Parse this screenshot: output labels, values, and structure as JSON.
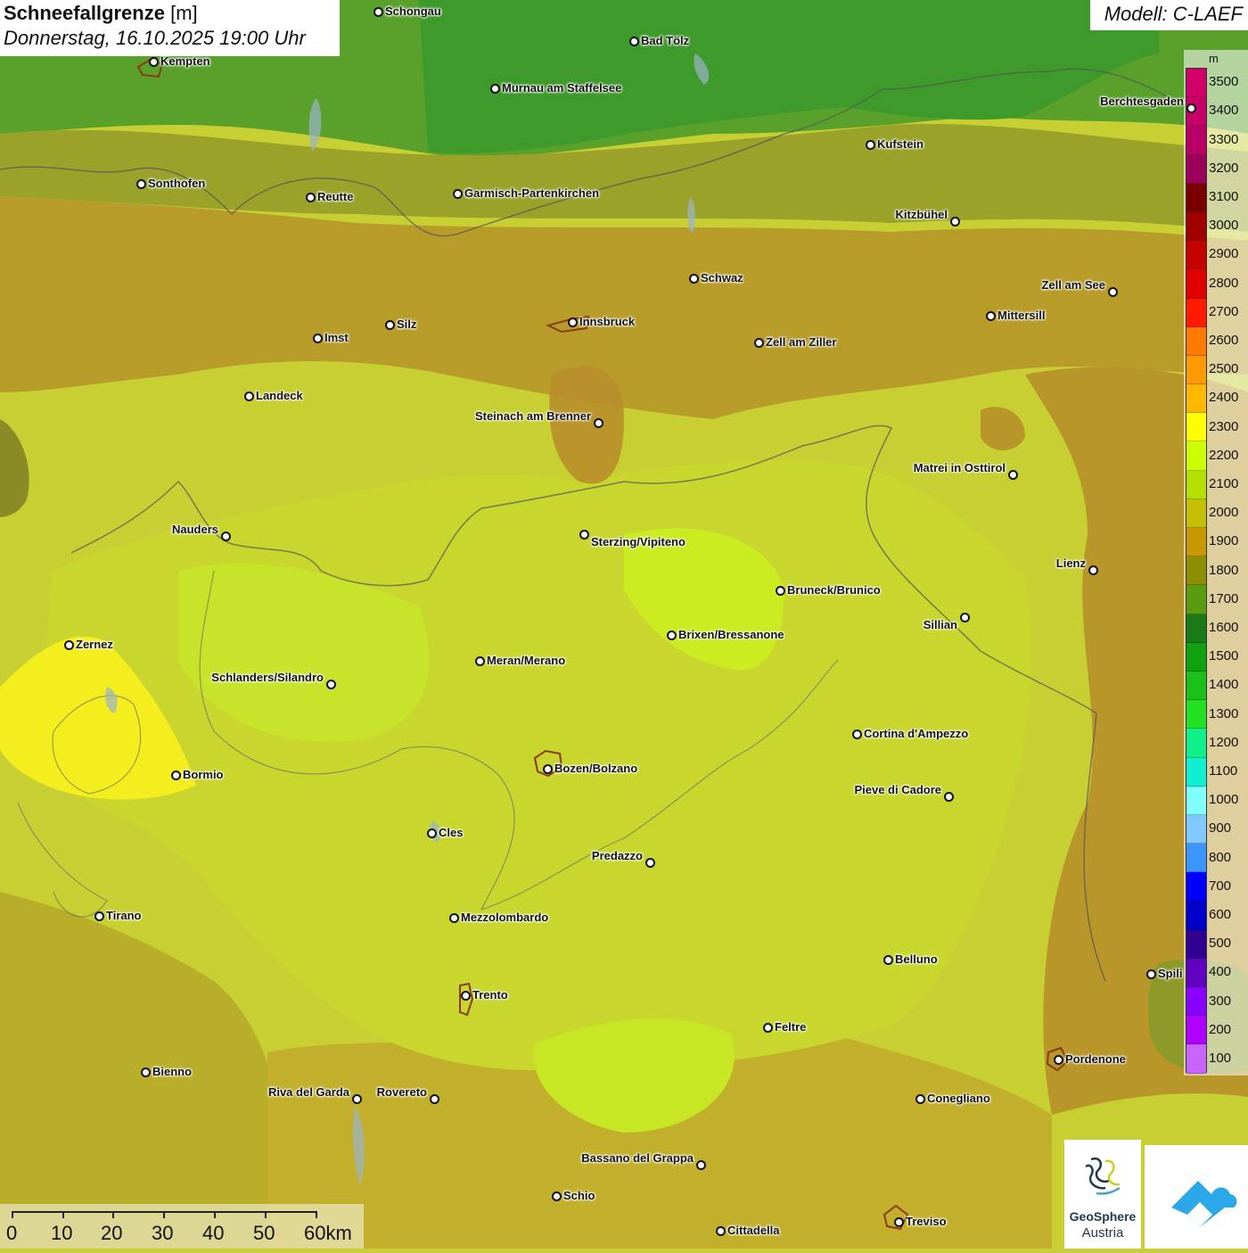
{
  "header": {
    "title": "Schneefallgrenze",
    "title_unit": "[m]",
    "datetime": "Donnerstag, 16.10.2025 19:00 Uhr",
    "model": "Modell: C-LAEF"
  },
  "legend": {
    "unit": "m",
    "labels": [
      "3500",
      "3400",
      "3300",
      "3200",
      "3100",
      "3000",
      "2900",
      "2800",
      "2700",
      "2600",
      "2500",
      "2400",
      "2300",
      "2200",
      "2100",
      "2000",
      "1900",
      "1800",
      "1700",
      "1600",
      "1500",
      "1400",
      "1300",
      "1200",
      "1100",
      "1000",
      "900",
      "800",
      "700",
      "600",
      "500",
      "400",
      "300",
      "200",
      "100"
    ],
    "colors": [
      "#d4006a",
      "#c8006a",
      "#b80066",
      "#9c0058",
      "#7a0000",
      "#a00000",
      "#c40000",
      "#e00000",
      "#ff1a00",
      "#ff7a00",
      "#ff9a00",
      "#ffb800",
      "#ffff00",
      "#ccff00",
      "#b4e000",
      "#c4bf00",
      "#c89800",
      "#8c9000",
      "#5c9a10",
      "#1a7a1a",
      "#10a010",
      "#18c018",
      "#22e022",
      "#10f08a",
      "#10f0d0",
      "#80ffff",
      "#80c8ff",
      "#3c96ff",
      "#0000ff",
      "#0000c8",
      "#300090",
      "#6000c0",
      "#8a00ff",
      "#b000ff",
      "#c864ff"
    ]
  },
  "cities": [
    {
      "name": "Schongau"
    },
    {
      "name": "Bad Tölz"
    },
    {
      "name": "Kempten"
    },
    {
      "name": "Murnau am Staffelsee"
    },
    {
      "name": "Berchtesgaden"
    },
    {
      "name": "Kufstein"
    },
    {
      "name": "Sonthofen"
    },
    {
      "name": "Reutte"
    },
    {
      "name": "Garmisch-Partenkirchen"
    },
    {
      "name": "Kitzbühel"
    },
    {
      "name": "Schwaz"
    },
    {
      "name": "Zell am See"
    },
    {
      "name": "Mittersill"
    },
    {
      "name": "Innsbruck"
    },
    {
      "name": "Imst"
    },
    {
      "name": "Silz"
    },
    {
      "name": "Zell am Ziller"
    },
    {
      "name": "Landeck"
    },
    {
      "name": "Steinach am Brenner"
    },
    {
      "name": "Matrei in Osttirol"
    },
    {
      "name": "Nauders"
    },
    {
      "name": "Sterzing/Vipiteno"
    },
    {
      "name": "Lienz"
    },
    {
      "name": "Bruneck/Brunico"
    },
    {
      "name": "Sillian"
    },
    {
      "name": "Brixen/Bressanone"
    },
    {
      "name": "Zernez"
    },
    {
      "name": "Meran/Merano"
    },
    {
      "name": "Schlanders/Silandro"
    },
    {
      "name": "Cortina d'Ampezzo"
    },
    {
      "name": "Bozen/Bolzano"
    },
    {
      "name": "Bormio"
    },
    {
      "name": "Pieve di Cadore"
    },
    {
      "name": "Cles"
    },
    {
      "name": "Predazzo"
    },
    {
      "name": "Tirano"
    },
    {
      "name": "Mezzolombardo"
    },
    {
      "name": "Belluno"
    },
    {
      "name": "Spili"
    },
    {
      "name": "Trento"
    },
    {
      "name": "Feltre"
    },
    {
      "name": "Pordenone"
    },
    {
      "name": "Bienno"
    },
    {
      "name": "Riva del Garda"
    },
    {
      "name": "Rovereto"
    },
    {
      "name": "Conegliano"
    },
    {
      "name": "Bassano del Grappa"
    },
    {
      "name": "Schio"
    },
    {
      "name": "Treviso"
    },
    {
      "name": "Cittadella"
    }
  ],
  "scalebar": {
    "labels": [
      "0",
      "10",
      "20",
      "30",
      "40",
      "50",
      "60km"
    ]
  },
  "logos": {
    "geosphere_line1": "GeoSphere",
    "geosphere_line2": "Austria"
  }
}
